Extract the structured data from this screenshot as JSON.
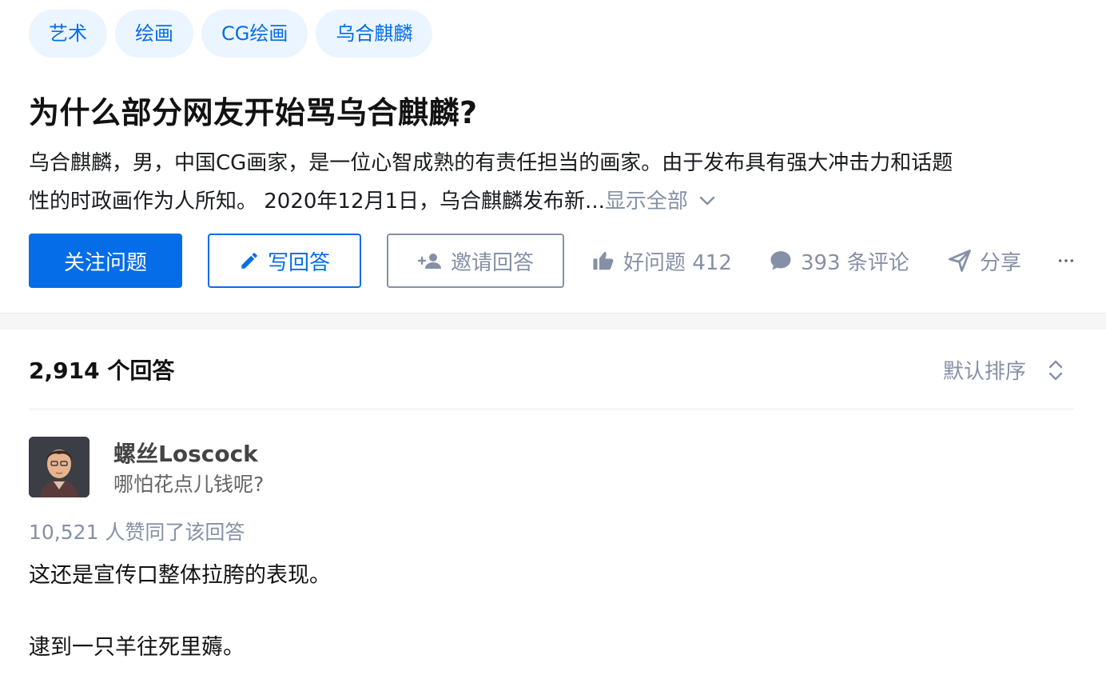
{
  "topics": [
    "艺术",
    "绘画",
    "CG绘画",
    "乌合麒麟"
  ],
  "question": {
    "title": "为什么部分网友开始骂乌合麒麟?",
    "desc_line1": "乌合麒麟，男，中国CG画家，是一位心智成熟的有责任担当的画家。由于发布具有强大冲击力和话题",
    "desc_line2": "性的时政画作为人所知。 2020年12月1日，乌合麒麟发布新...",
    "show_all": "显示全部"
  },
  "actions": {
    "follow": "关注问题",
    "write": "写回答",
    "invite": "邀请回答",
    "good_question": "好问题 412",
    "comments": "393 条评论",
    "share": "分享"
  },
  "answers": {
    "count": "2,914 个回答",
    "sort": "默认排序"
  },
  "answer": {
    "author": "螺丝Loscock",
    "bio": "哪怕花点儿钱呢?",
    "votes": "10,521 人赞同了该回答",
    "p1": "这还是宣传口整体拉胯的表现。",
    "p2": "逮到一只羊往死里薅。"
  },
  "colors": {
    "brand": "#056de8",
    "muted": "#8590a6",
    "topic_bg": "#ebf5ff"
  }
}
